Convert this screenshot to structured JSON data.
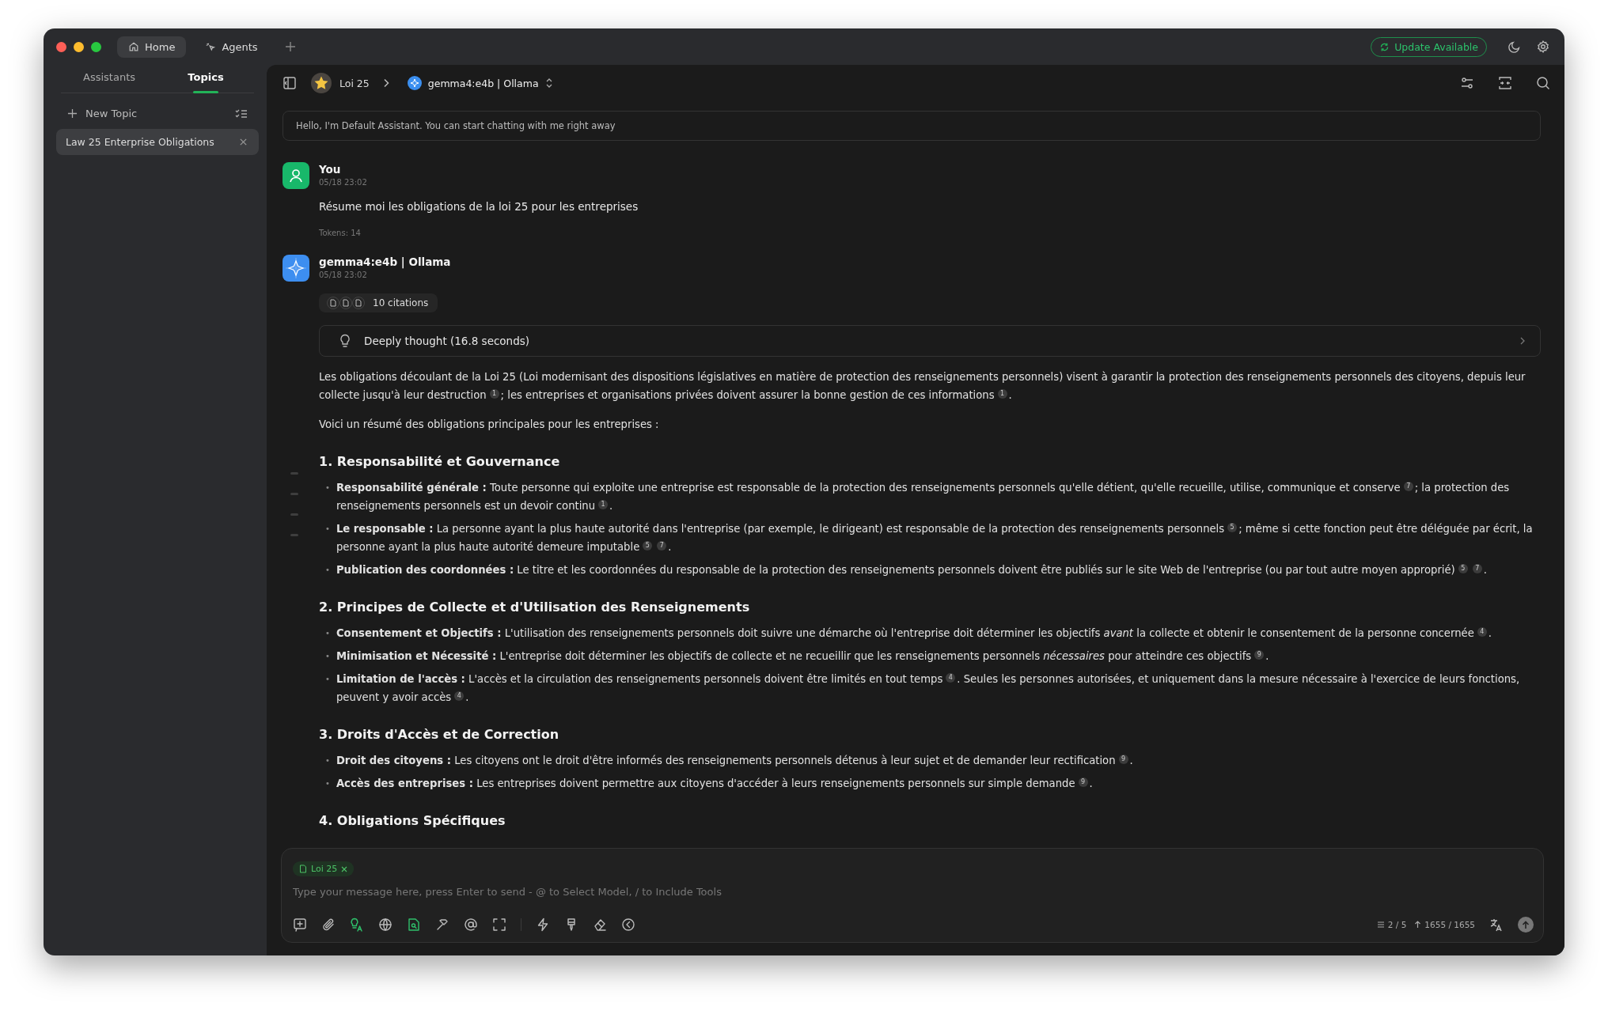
{
  "window": {
    "tabs": [
      {
        "label": "Home",
        "kind": "home",
        "selected": true
      },
      {
        "label": "Agents",
        "kind": "agents",
        "selected": false
      }
    ],
    "update_button": "Update Available"
  },
  "sidebar": {
    "tabs": [
      {
        "label": "Assistants",
        "selected": false
      },
      {
        "label": "Topics",
        "selected": true
      }
    ],
    "new_topic": "New Topic",
    "topics": [
      {
        "title": "Law 25 Enterprise Obligations",
        "selected": true
      }
    ]
  },
  "chat_header": {
    "assistant": "Loi 25",
    "model": "gemma4:e4b | Ollama"
  },
  "greeting": "Hello, I'm Default Assistant. You can start chatting with me right away",
  "messages": [
    {
      "kind": "user",
      "author": "You",
      "time": "05/18 23:02",
      "text": "Résume moi les obligations de la loi 25 pour les entreprises",
      "tokens": "Tokens: 14"
    },
    {
      "kind": "assistant",
      "author": "gemma4:e4b | Ollama",
      "time": "05/18 23:02",
      "citations": "10 citations",
      "thinking": "Deeply thought (16.8 seconds)",
      "blocks": [
        {
          "kind": "p",
          "parts": [
            {
              "kind": "text",
              "text": "Les obligations découlant de la Loi 25 (Loi modernisant des dispositions législatives en matière de protection des renseignements personnels) visent à garantir la protection des renseignements personnels des citoyens, depuis leur collecte jusqu'à leur destruction"
            },
            {
              "kind": "cite",
              "text": "1"
            },
            {
              "kind": "text",
              "text": "; les entreprises et organisations privées doivent assurer la bonne gestion de ces informations"
            },
            {
              "kind": "cite",
              "text": "1"
            },
            {
              "kind": "text",
              "text": "."
            }
          ]
        },
        {
          "kind": "p",
          "parts": [
            {
              "kind": "text",
              "text": "Voici un résumé des obligations principales pour les entreprises :"
            }
          ]
        },
        {
          "kind": "h3",
          "text": "1. Responsabilité et Gouvernance"
        },
        {
          "kind": "ul",
          "marker": "•",
          "items": [
            {
              "parts": [
                {
                  "kind": "text",
                  "text": "**Responsabilité générale :** Toute personne qui exploite une entreprise est responsable de la protection des renseignements personnels qu'elle détient, qu'elle recueille, utilise, communique et conserve"
                },
                {
                  "kind": "cite",
                  "text": "7"
                },
                {
                  "kind": "text",
                  "text": "; la protection des renseignements personnels est un devoir continu"
                },
                {
                  "kind": "cite",
                  "text": "1"
                },
                {
                  "kind": "text",
                  "text": "."
                }
              ]
            },
            {
              "parts": [
                {
                  "kind": "text",
                  "text": "**Le responsable :** La personne ayant la plus haute autorité dans l'entreprise (par exemple, le dirigeant) est responsable de la protection des renseignements personnels"
                },
                {
                  "kind": "cite",
                  "text": "5"
                },
                {
                  "kind": "text",
                  "text": "; même si cette fonction peut être déléguée par écrit, la personne ayant la plus haute autorité demeure imputable"
                },
                {
                  "kind": "cite",
                  "text": "5"
                },
                {
                  "kind": "cite",
                  "text": "7"
                },
                {
                  "kind": "text",
                  "text": "."
                }
              ]
            },
            {
              "parts": [
                {
                  "kind": "text",
                  "text": "**Publication des coordonnées :** Le titre et les coordonnées du responsable de la protection des renseignements personnels doivent être publiés sur le site Web de l'entreprise (ou par tout autre moyen approprié)"
                },
                {
                  "kind": "cite",
                  "text": "5"
                },
                {
                  "kind": "cite",
                  "text": "7"
                },
                {
                  "kind": "text",
                  "text": "."
                }
              ]
            }
          ]
        },
        {
          "kind": "h3",
          "text": "2. Principes de Collecte et d'Utilisation des Renseignements"
        },
        {
          "kind": "ul",
          "marker": "•",
          "items": [
            {
              "parts": [
                {
                  "kind": "text",
                  "text": "**Consentement et Objectifs :** L'utilisation des renseignements personnels doit suivre une démarche où l'entreprise doit déterminer les objectifs *avant* la collecte et obtenir le consentement de la personne concernée"
                },
                {
                  "kind": "cite",
                  "text": "4"
                },
                {
                  "kind": "text",
                  "text": "."
                }
              ]
            },
            {
              "parts": [
                {
                  "kind": "text",
                  "text": "**Minimisation et Nécessité :** L'entreprise doit déterminer les objectifs de collecte et ne recueillir que les renseignements personnels *nécessaires* pour atteindre ces objectifs"
                },
                {
                  "kind": "cite",
                  "text": "9"
                },
                {
                  "kind": "text",
                  "text": "."
                }
              ]
            },
            {
              "parts": [
                {
                  "kind": "text",
                  "text": "**Limitation de l'accès :** L'accès et la circulation des renseignements personnels doivent être limités en tout temps"
                },
                {
                  "kind": "cite",
                  "text": "4"
                },
                {
                  "kind": "text",
                  "text": ". Seules les personnes autorisées, et uniquement dans la mesure nécessaire à l'exercice de leurs fonctions, peuvent y avoir accès"
                },
                {
                  "kind": "cite",
                  "text": "4"
                },
                {
                  "kind": "text",
                  "text": "."
                }
              ]
            }
          ]
        },
        {
          "kind": "h3",
          "text": "3. Droits d'Accès et de Correction"
        },
        {
          "kind": "ul",
          "marker": "•",
          "items": [
            {
              "parts": [
                {
                  "kind": "text",
                  "text": "**Droit des citoyens :** Les citoyens ont le droit d'être informés des renseignements personnels détenus à leur sujet et de demander leur rectification"
                },
                {
                  "kind": "cite",
                  "text": "9"
                },
                {
                  "kind": "text",
                  "text": "."
                }
              ]
            },
            {
              "parts": [
                {
                  "kind": "text",
                  "text": "**Accès des entreprises :** Les entreprises doivent permettre aux citoyens d'accéder à leurs renseignements personnels sur simple demande"
                },
                {
                  "kind": "cite",
                  "text": "9"
                },
                {
                  "kind": "text",
                  "text": "."
                }
              ]
            }
          ]
        },
        {
          "kind": "h3",
          "text": "4. Obligations Spécifiques"
        }
      ]
    }
  ],
  "composer": {
    "tag": "Loi 25",
    "placeholder": "Type your message here, press Enter to send - @ to Select Model, / to Include Tools",
    "tools": [
      {
        "kind": "new-context",
        "active": false
      },
      {
        "kind": "attach",
        "active": false
      },
      {
        "kind": "think",
        "active": true
      },
      {
        "kind": "web",
        "active": false
      },
      {
        "kind": "knowledge",
        "active": true
      },
      {
        "kind": "tools",
        "active": false
      },
      {
        "kind": "mention",
        "active": false
      },
      {
        "kind": "expand",
        "active": false
      },
      {
        "kind": "divider"
      },
      {
        "kind": "quick",
        "active": false
      },
      {
        "kind": "pin",
        "active": false
      },
      {
        "kind": "clear",
        "active": false
      },
      {
        "kind": "collapse",
        "active": false
      }
    ],
    "context_count": "2 / 5",
    "token_count": "1655 / 1655"
  }
}
